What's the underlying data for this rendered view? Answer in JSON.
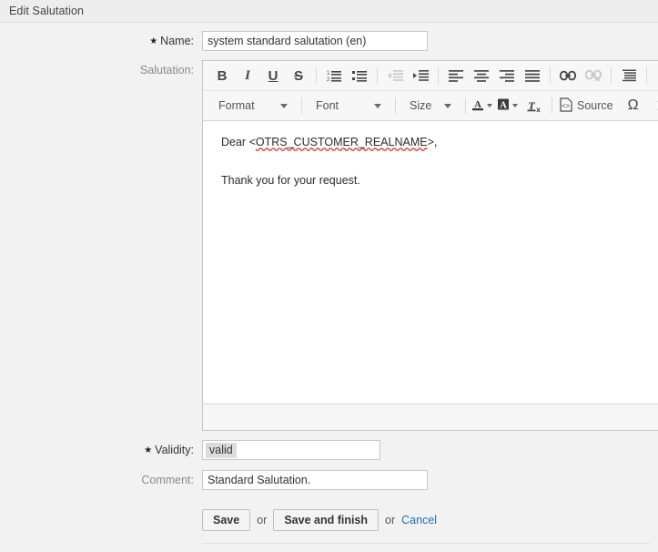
{
  "window": {
    "title": "Edit Salutation"
  },
  "form": {
    "name": {
      "label": "Name:",
      "value": "system standard salutation (en)",
      "required": true
    },
    "salutation": {
      "label": "Salutation:"
    },
    "validity": {
      "label": "Validity:",
      "selected": "valid",
      "required": true
    },
    "comment": {
      "label": "Comment:",
      "value": "Standard Salutation."
    }
  },
  "editor": {
    "toolbar_row1": [
      {
        "name": "bold-icon",
        "label": "B",
        "kind": "text",
        "style": "bold",
        "disabled": false
      },
      {
        "name": "italic-icon",
        "label": "I",
        "kind": "text",
        "style": "italic",
        "disabled": false
      },
      {
        "name": "underline-icon",
        "label": "U",
        "kind": "text",
        "style": "underline",
        "disabled": false
      },
      {
        "name": "strikethrough-icon",
        "label": "S",
        "kind": "text",
        "style": "strike",
        "disabled": false
      },
      {
        "name": "separator",
        "kind": "sep"
      },
      {
        "name": "numbered-list-icon",
        "kind": "icon",
        "glyph": "numlist",
        "disabled": false
      },
      {
        "name": "bulleted-list-icon",
        "kind": "icon",
        "glyph": "bullist",
        "disabled": false
      },
      {
        "name": "separator",
        "kind": "sep"
      },
      {
        "name": "decrease-indent-icon",
        "kind": "icon",
        "glyph": "outdent",
        "disabled": true
      },
      {
        "name": "increase-indent-icon",
        "kind": "icon",
        "glyph": "indent",
        "disabled": false
      },
      {
        "name": "separator",
        "kind": "sep"
      },
      {
        "name": "align-left-icon",
        "kind": "icon",
        "glyph": "alignleft",
        "disabled": false
      },
      {
        "name": "align-center-icon",
        "kind": "icon",
        "glyph": "aligncenter",
        "disabled": false
      },
      {
        "name": "align-right-icon",
        "kind": "icon",
        "glyph": "alignright",
        "disabled": false
      },
      {
        "name": "align-justify-icon",
        "kind": "icon",
        "glyph": "alignjustify",
        "disabled": false
      },
      {
        "name": "separator",
        "kind": "sep"
      },
      {
        "name": "link-icon",
        "kind": "icon",
        "glyph": "link",
        "disabled": false
      },
      {
        "name": "unlink-icon",
        "kind": "icon",
        "glyph": "unlink",
        "disabled": true
      },
      {
        "name": "separator",
        "kind": "sep"
      },
      {
        "name": "blockquote-icon",
        "kind": "icon",
        "glyph": "blockquote",
        "disabled": false
      },
      {
        "name": "separator",
        "kind": "sep"
      },
      {
        "name": "undo-icon",
        "kind": "icon",
        "glyph": "undo",
        "disabled": true
      }
    ],
    "combos": {
      "format": "Format",
      "font": "Font",
      "size": "Size"
    },
    "source_label": "Source",
    "special_char": "Ω",
    "content": {
      "line1_prefix": "Dear <",
      "line1_placeholder": "OTRS_CUSTOMER_REALNAME",
      "line1_suffix": ">,",
      "line2": "Thank you for your request."
    }
  },
  "actions": {
    "save": "Save",
    "or_1": "or",
    "save_and_finish": "Save and finish",
    "or_2": "or",
    "cancel": "Cancel"
  },
  "colors": {
    "link": "#1a6fb5",
    "spellcheck_underline": "#e02b2b",
    "page_bg": "#f2f2f2",
    "header_bg": "#ededed"
  }
}
